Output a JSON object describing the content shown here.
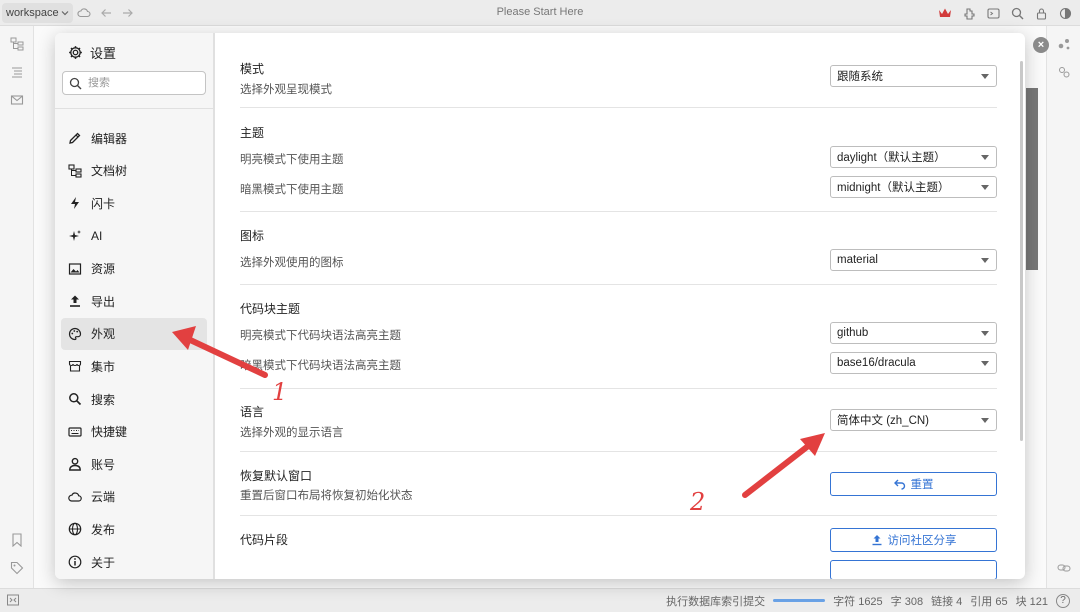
{
  "app": {
    "workspace_label": "workspace",
    "window_title": "Please Start Here"
  },
  "dialog": {
    "title": "设置",
    "search_placeholder": "搜索",
    "close_icon": "x-circle-icon",
    "nav": [
      {
        "label": "编辑器",
        "icon": "edit-icon",
        "active": false
      },
      {
        "label": "文档树",
        "icon": "tree-icon",
        "active": false
      },
      {
        "label": "闪卡",
        "icon": "flash-icon",
        "active": false
      },
      {
        "label": "AI",
        "icon": "sparkle-icon",
        "active": false
      },
      {
        "label": "资源",
        "icon": "image-icon",
        "active": false
      },
      {
        "label": "导出",
        "icon": "upload-icon",
        "active": false
      },
      {
        "label": "外观",
        "icon": "palette-icon",
        "active": true
      },
      {
        "label": "集市",
        "icon": "store-icon",
        "active": false
      },
      {
        "label": "搜索",
        "icon": "search-icon",
        "active": false
      },
      {
        "label": "快捷键",
        "icon": "keyboard-icon",
        "active": false
      },
      {
        "label": "账号",
        "icon": "user-icon",
        "active": false
      },
      {
        "label": "云端",
        "icon": "cloud-icon",
        "active": false
      },
      {
        "label": "发布",
        "icon": "globe-icon",
        "active": false
      },
      {
        "label": "关于",
        "icon": "info-icon",
        "active": false
      }
    ]
  },
  "appearance": {
    "mode": {
      "title": "模式",
      "desc": "选择外观呈现模式",
      "value": "跟随系统"
    },
    "theme": {
      "title": "主题",
      "light_label": "明亮模式下使用主题",
      "light_value": "daylight（默认主题）",
      "dark_label": "暗黑模式下使用主题",
      "dark_value": "midnight（默认主题）"
    },
    "icon": {
      "title": "图标",
      "desc": "选择外观使用的图标",
      "value": "material"
    },
    "codeblock": {
      "title": "代码块主题",
      "light_label": "明亮模式下代码块语法高亮主题",
      "light_value": "github",
      "dark_label": "暗黑模式下代码块语法高亮主题",
      "dark_value": "base16/dracula"
    },
    "language": {
      "title": "语言",
      "desc": "选择外观的显示语言",
      "value": "简体中文 (zh_CN)"
    },
    "reset_window": {
      "title": "恢复默认窗口",
      "desc": "重置后窗口布局将恢复初始化状态",
      "button": "重置"
    },
    "snippets": {
      "title": "代码片段",
      "button": "访问社区分享"
    }
  },
  "status": {
    "task": "执行数据库索引提交",
    "chars": "字符 1625",
    "words": "字 308",
    "links": "链接 4",
    "refs": "引用 65",
    "blocks": "块 121",
    "help": "?"
  },
  "annotations": [
    "1",
    "2"
  ],
  "colors": {
    "accent": "#3574d4",
    "annotation": "#e24040",
    "active_nav": "#e4e4e4"
  }
}
